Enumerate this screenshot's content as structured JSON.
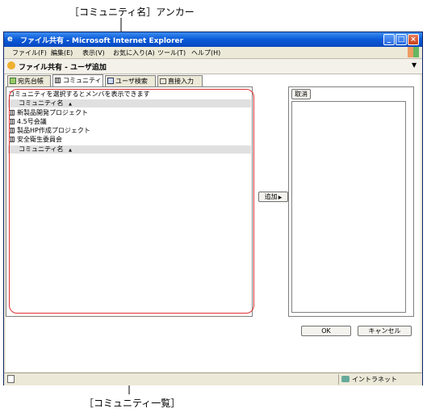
{
  "callouts": {
    "top": "［コミュニティ名］アンカー",
    "bottom": "［コミュニティ一覧］"
  },
  "window": {
    "title": "ファイル共有 - Microsoft Internet Explorer",
    "controls": {
      "minimize": "_",
      "maximize": "□",
      "close": "×"
    }
  },
  "menu": [
    "ファイル(F)",
    "編集(E)",
    "表示(V)",
    "お気に入り(A)",
    "ツール(T)",
    "ヘルプ(H)"
  ],
  "page_header": "ファイル共有 - ユーザ追加",
  "tabs": [
    {
      "label": "宛先台帳",
      "icon": "address-book-icon"
    },
    {
      "label": "コミュニティ",
      "icon": "grid-icon",
      "active": true
    },
    {
      "label": "ユーザ検索",
      "icon": "user-search-icon"
    },
    {
      "label": "直接入力",
      "icon": "text-input-icon"
    }
  ],
  "community_panel": {
    "hint": "コミュニティを選択するとメンバを表示できます",
    "column_header": "コミュニティ名",
    "sort_indicator": "▲",
    "items": [
      "新製品開発プロジェクト",
      "4.5号会議",
      "製品HP作成プロジェクト",
      "安全衛生委員会"
    ]
  },
  "buttons": {
    "add": "追加",
    "add_arrow": "▶",
    "cancel_selection": "取消",
    "ok": "OK",
    "cancel": "キャンセル"
  },
  "status": {
    "zone": "イントラネット"
  },
  "colors": {
    "titlebar": "#0a5ad8",
    "highlight_box": "#e03030",
    "window_bg": "#ece9d8"
  }
}
